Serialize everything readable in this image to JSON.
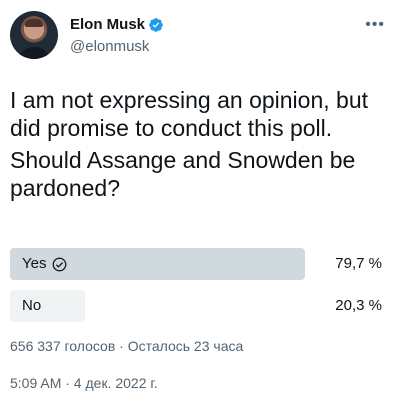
{
  "author": {
    "name": "Elon Musk",
    "handle": "@elonmusk",
    "verified_color": "#1d9bf0"
  },
  "more_icon": "•••",
  "tweet": {
    "text": "I am not expressing an opinion, but did promise to conduct this poll.",
    "question": "Should Assange and Snowden be pardoned?"
  },
  "poll": {
    "options": [
      {
        "label": "Yes",
        "percent_text": "79,7 %",
        "percent": 79.7,
        "is_leader": true
      },
      {
        "label": "No",
        "percent_text": "20,3 %",
        "percent": 20.3,
        "is_leader": false
      }
    ],
    "meta": "656 337 голосов · Осталось 23 часа"
  },
  "timestamp": "5:09 AM · 4 дек. 2022 г."
}
